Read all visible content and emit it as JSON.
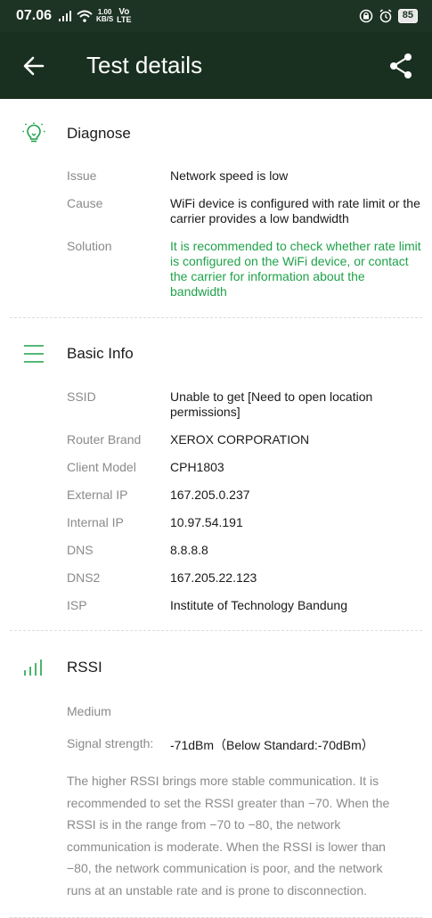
{
  "status_bar": {
    "time": "07.06",
    "net_speed_value": "1.00",
    "net_speed_unit": "KB/S",
    "vo_label": "Vo",
    "lte_label": "LTE",
    "battery": "85"
  },
  "toolbar": {
    "title": "Test details"
  },
  "diagnose": {
    "title": "Diagnose",
    "rows": [
      {
        "label": "Issue",
        "value": "Network speed is low"
      },
      {
        "label": "Cause",
        "value": "WiFi device is configured with rate limit or the carrier provides a low bandwidth"
      },
      {
        "label": "Solution",
        "value": "It is recommended to check whether rate limit is configured on the WiFi device, or contact the carrier for information about the bandwidth"
      }
    ],
    "accent": "#1fa24a"
  },
  "basic_info": {
    "title": "Basic Info",
    "rows": [
      {
        "label": "SSID",
        "value": "Unable to get [Need to open location permissions]"
      },
      {
        "label": "Router Brand",
        "value": "XEROX CORPORATION"
      },
      {
        "label": "Client Model",
        "value": "CPH1803"
      },
      {
        "label": "External IP",
        "value": "167.205.0.237"
      },
      {
        "label": "Internal IP",
        "value": "10.97.54.191"
      },
      {
        "label": "DNS",
        "value": "8.8.8.8"
      },
      {
        "label": "DNS2",
        "value": "167.205.22.123"
      },
      {
        "label": "ISP",
        "value": "Institute of Technology Bandung"
      }
    ]
  },
  "rssi": {
    "title": "RSSI",
    "level": "Medium",
    "strength_label": "Signal strength:",
    "strength_value": "-71dBm（Below Standard:-70dBm）",
    "description": "The higher RSSI brings more stable communication. It is recommended to set the RSSI greater than −70. When the RSSI is in the range from −70 to −80, the network communication is moderate. When the RSSI is lower than −80, the network communication is poor, and the network runs at an unstable rate and is prone to disconnection."
  },
  "colors": {
    "toolbar": "#193020",
    "icon_green": "#1fa24a"
  }
}
